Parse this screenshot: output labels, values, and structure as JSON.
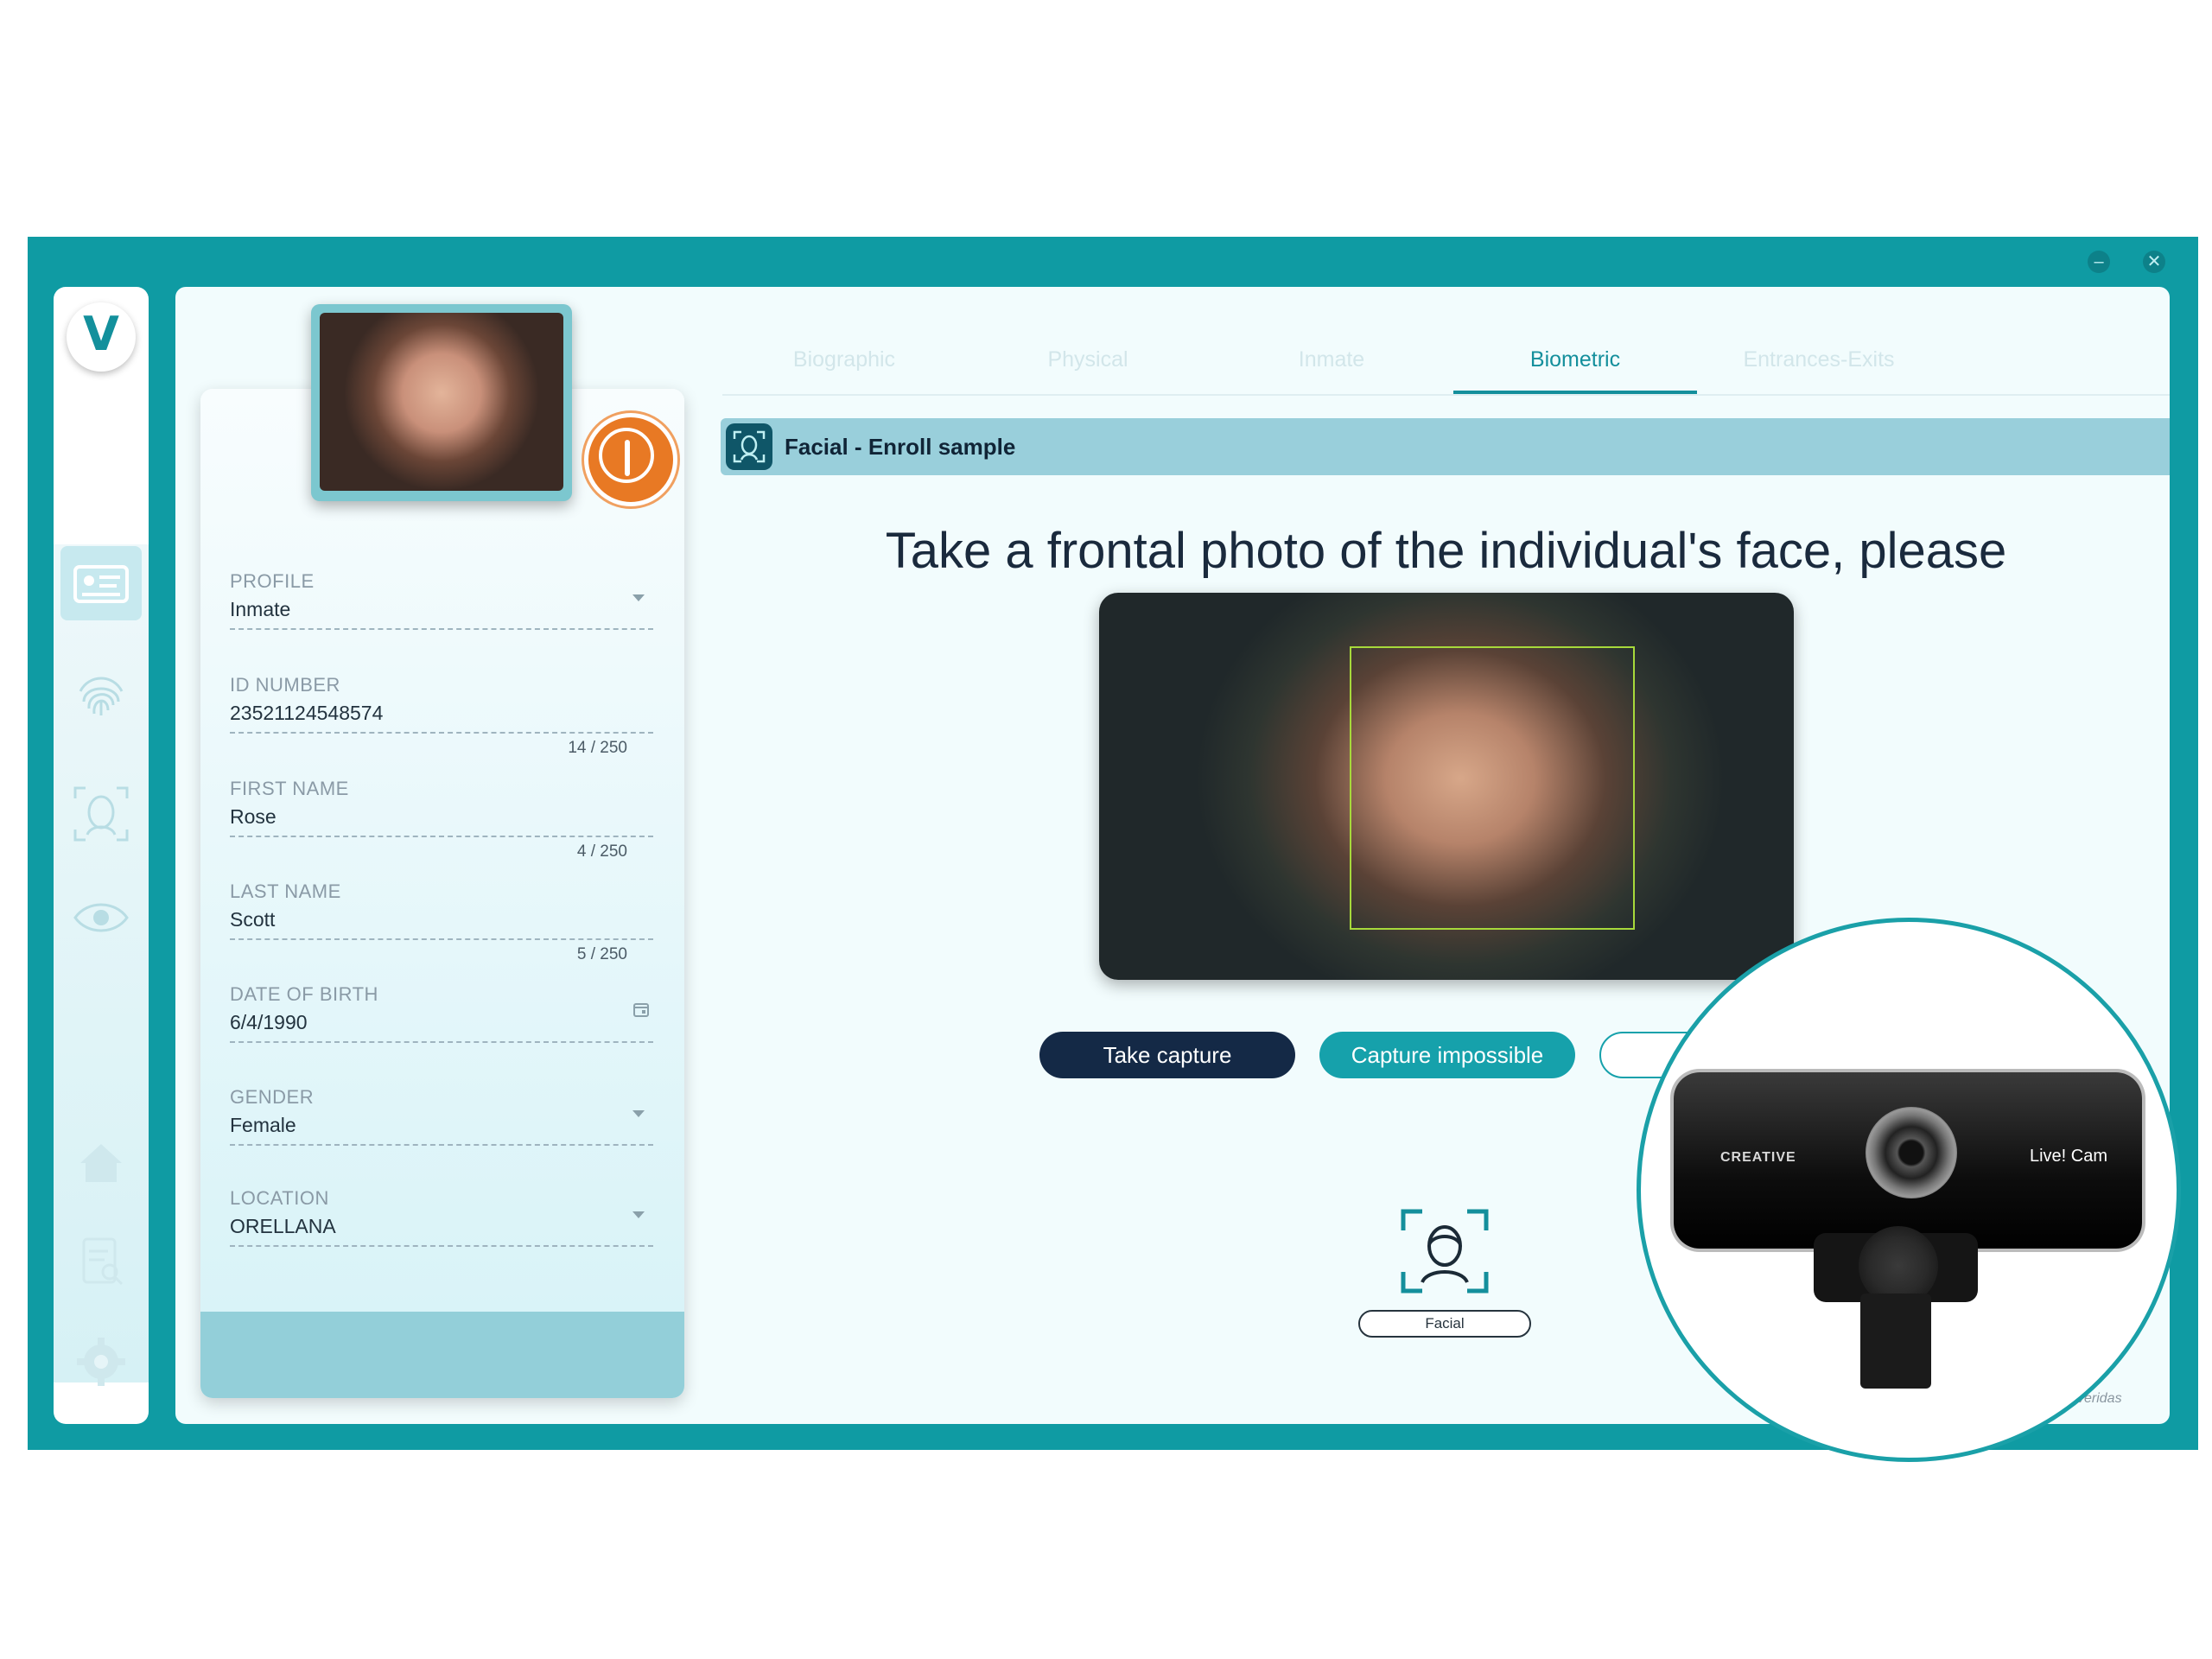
{
  "window": {
    "minimize_icon": "minimize-icon",
    "close_icon": "close-icon",
    "brand_color": "#0f9ba3"
  },
  "sidebar": {
    "logo_letter": "V",
    "items": [
      {
        "name": "id-card-icon",
        "active": true
      },
      {
        "name": "fingerprint-icon",
        "active": false
      },
      {
        "name": "face-scan-icon",
        "active": false
      },
      {
        "name": "eye-icon",
        "active": false
      },
      {
        "name": "home-icon",
        "active": false
      },
      {
        "name": "report-search-icon",
        "active": false
      },
      {
        "name": "settings-icon",
        "active": false
      }
    ]
  },
  "profile_card": {
    "status_color": "#e87924",
    "fields": {
      "profile": {
        "label": "PROFILE",
        "value": "Inmate"
      },
      "id_number": {
        "label": "ID NUMBER",
        "value": "23521124548574",
        "count": "14 / 250"
      },
      "first_name": {
        "label": "FIRST NAME",
        "value": "Rose",
        "count": "4 / 250"
      },
      "last_name": {
        "label": "LAST NAME",
        "value": "Scott",
        "count": "5 / 250"
      },
      "dob": {
        "label": "DATE OF BIRTH",
        "value": "6/4/1990"
      },
      "gender": {
        "label": "GENDER",
        "value": "Female"
      },
      "location": {
        "label": "LOCATION",
        "value": "ORELLANA"
      }
    }
  },
  "tabs": [
    "Biographic",
    "Physical",
    "Inmate",
    "Biometric",
    "Entrances-Exits"
  ],
  "active_tab": "Biometric",
  "section": {
    "title": "Facial - Enroll sample"
  },
  "capture": {
    "instruction": "Take a frontal photo of the individual's face, please",
    "take_capture_label": "Take capture",
    "capture_impossible_label": "Capture impossible",
    "modality_label": "Facial"
  },
  "brand": "veridas",
  "webcam": {
    "brand_text": "CREATIVE",
    "model_text": "Live! Cam"
  }
}
